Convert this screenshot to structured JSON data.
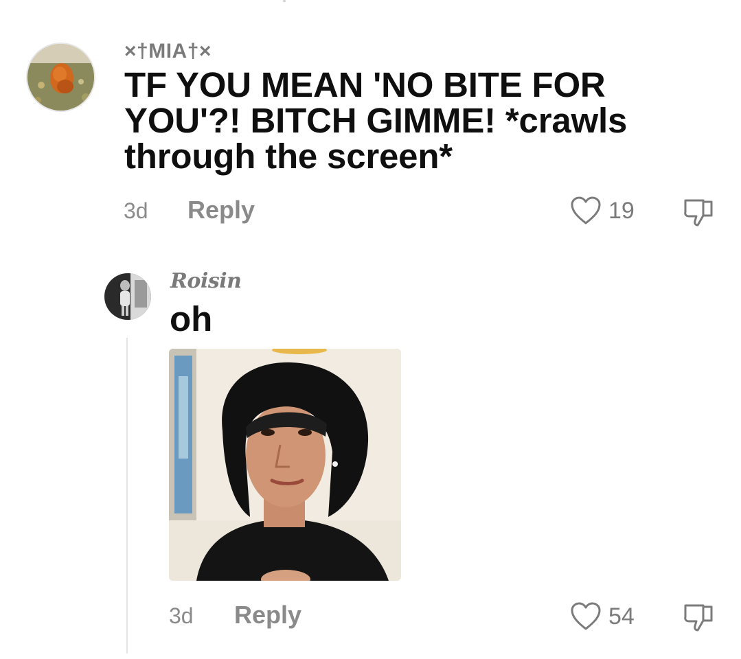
{
  "comments": [
    {
      "username": "×†MIA†×",
      "text": "TF YOU MEAN 'NO BITE FOR YOU'?! BITCH GIMME! *crawls through the screen*",
      "time": "3d",
      "reply_label": "Reply",
      "likes": "19",
      "avatar_icon": "avatar-photo-flower-field"
    },
    {
      "username": "Roisin",
      "text": "oh",
      "time": "3d",
      "reply_label": "Reply",
      "likes": "54",
      "avatar_icon": "avatar-photo-bw-person",
      "image_icon": "photo-person-black-bonnet"
    }
  ],
  "icons": {
    "like": "heart-outline-icon",
    "dislike": "thumbs-down-outline-icon"
  },
  "colors": {
    "text_primary": "#0f0f0f",
    "text_secondary": "#8a8a8a",
    "username_grey": "#7a7a7a",
    "thread_line": "#e4e4e4"
  }
}
